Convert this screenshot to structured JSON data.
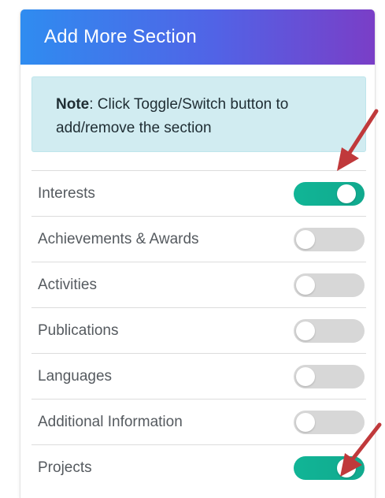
{
  "header": {
    "title": "Add More Section"
  },
  "note": {
    "prefix": "Note",
    "text": ": Click Toggle/Switch button to add/remove the section"
  },
  "sections": [
    {
      "label": "Interests",
      "enabled": true
    },
    {
      "label": "Achievements & Awards",
      "enabled": false
    },
    {
      "label": "Activities",
      "enabled": false
    },
    {
      "label": "Publications",
      "enabled": false
    },
    {
      "label": "Languages",
      "enabled": false
    },
    {
      "label": "Additional Information",
      "enabled": false
    },
    {
      "label": "Projects",
      "enabled": true
    }
  ],
  "colors": {
    "header_gradient_start": "#2f8cf0",
    "header_gradient_end": "#7a3ec7",
    "note_background": "#d1ecf1",
    "toggle_on": "#11b596",
    "toggle_off": "#d7d7d7",
    "arrow": "#c0393b"
  }
}
